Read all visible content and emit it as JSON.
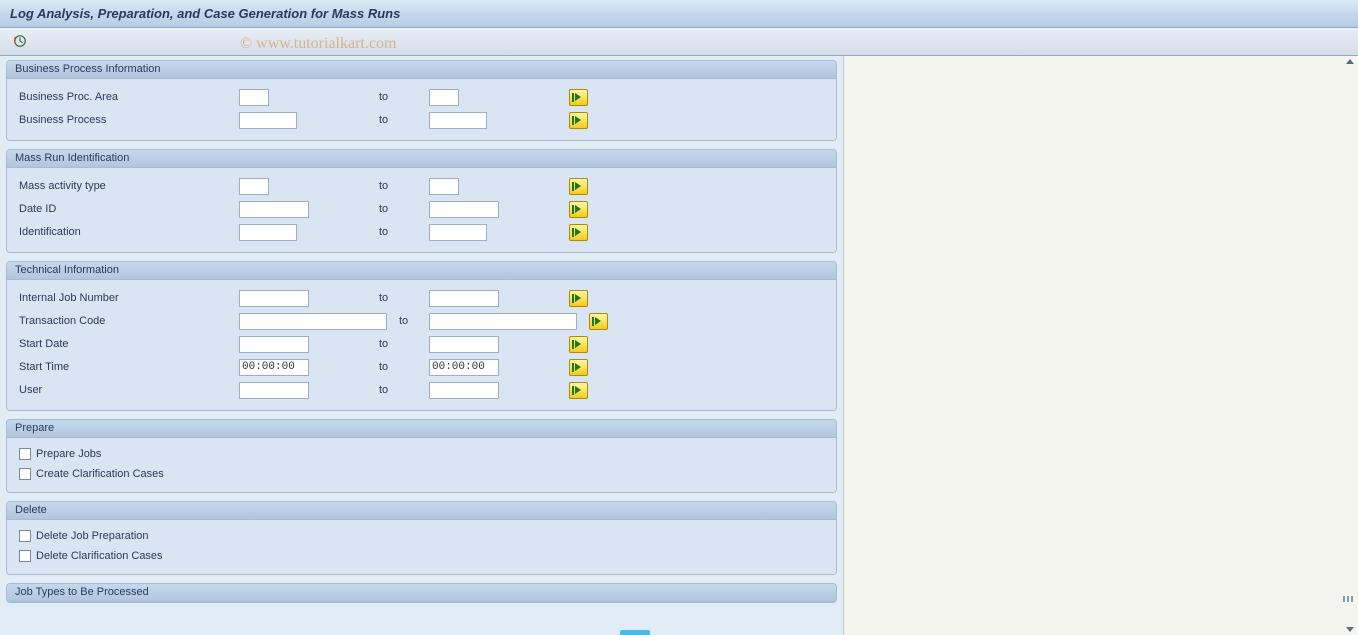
{
  "title": "Log Analysis, Preparation, and Case Generation for Mass Runs",
  "watermark": "© www.tutorialkart.com",
  "toolbar": {
    "execute_tooltip": "Execute"
  },
  "groups": {
    "bpi": {
      "title": "Business Process Information",
      "rows": {
        "proc_area": {
          "label": "Business Proc. Area",
          "to": "to",
          "from_val": "",
          "to_val": ""
        },
        "process": {
          "label": "Business Process",
          "to": "to",
          "from_val": "",
          "to_val": ""
        }
      }
    },
    "mri": {
      "title": "Mass Run Identification",
      "rows": {
        "act_type": {
          "label": "Mass activity type",
          "to": "to",
          "from_val": "",
          "to_val": ""
        },
        "date_id": {
          "label": "Date ID",
          "to": "to",
          "from_val": "",
          "to_val": ""
        },
        "ident": {
          "label": "Identification",
          "to": "to",
          "from_val": "",
          "to_val": ""
        }
      }
    },
    "tech": {
      "title": "Technical Information",
      "rows": {
        "job_num": {
          "label": "Internal Job Number",
          "to": "to",
          "from_val": "",
          "to_val": ""
        },
        "tcode": {
          "label": "Transaction Code",
          "to": "to",
          "from_val": "",
          "to_val": ""
        },
        "sdate": {
          "label": "Start Date",
          "to": "to",
          "from_val": "",
          "to_val": ""
        },
        "stime": {
          "label": "Start Time",
          "to": "to",
          "from_val": "00:00:00",
          "to_val": "00:00:00"
        },
        "user": {
          "label": "User",
          "to": "to",
          "from_val": "",
          "to_val": ""
        }
      }
    },
    "prepare": {
      "title": "Prepare",
      "checks": {
        "prep_jobs": "Prepare Jobs",
        "create_cc": "Create Clarification Cases"
      }
    },
    "delete": {
      "title": "Delete",
      "checks": {
        "del_prep": "Delete Job Preparation",
        "del_cc": "Delete Clarification Cases"
      }
    },
    "jobtypes": {
      "title": "Job Types to Be Processed"
    }
  }
}
